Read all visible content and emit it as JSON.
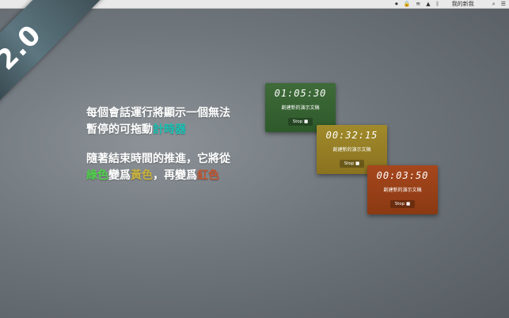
{
  "badge": {
    "text": "2.0"
  },
  "menubar": {
    "icons": [
      "record-icon",
      "lock-icon",
      "wifi-icon",
      "airplay-icon",
      "bluetooth-icon"
    ],
    "user": "我的新我",
    "right_icons": [
      "search-icon",
      "list-icon"
    ]
  },
  "copy": {
    "line1_a": "每個會話運行將顯示一個無法暫停的可拖動",
    "line1_b": "計時器",
    "line2_a": "隨著結束時間的推進，它將從",
    "line2_green": "綠色",
    "line2_b": "變爲",
    "line2_yellow": "黃色",
    "line2_c": "，再變爲",
    "line2_red": "紅色"
  },
  "timers": [
    {
      "time": "01:05:30",
      "subtitle": "創建新的演示文稿",
      "stop_label": "Stop ■",
      "color": "#3f6b3a"
    },
    {
      "time": "00:32:15",
      "subtitle": "創建新的演示文稿",
      "stop_label": "Stop ■",
      "color": "#a08a2a"
    },
    {
      "time": "00:03:50",
      "subtitle": "創建新的演示文稿",
      "stop_label": "Stop ■",
      "color": "#a6471d"
    }
  ]
}
